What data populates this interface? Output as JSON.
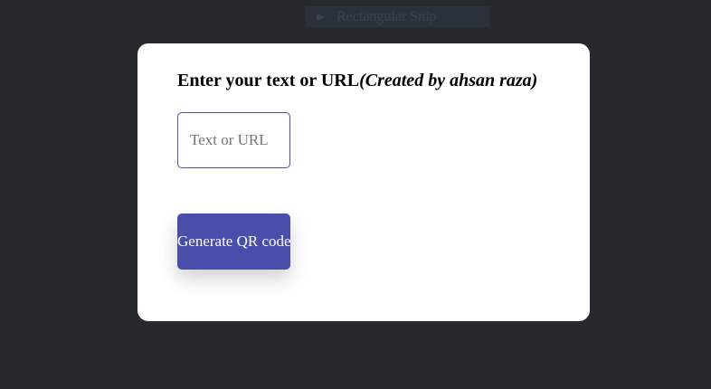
{
  "toolbar": {
    "label": "Rectangular Snip",
    "icon": "snip-arrow-icon"
  },
  "form": {
    "heading": "Enter your text or URL",
    "heading_credit": "(Created by ahsan raza)",
    "input_placeholder": "Text or URL",
    "input_value": "",
    "button_label": "Generate QR code"
  },
  "colors": {
    "page_background": "#262a2f",
    "card_background": "#ffffff",
    "accent": "#494eab",
    "input_border": "#4a4fa8"
  }
}
